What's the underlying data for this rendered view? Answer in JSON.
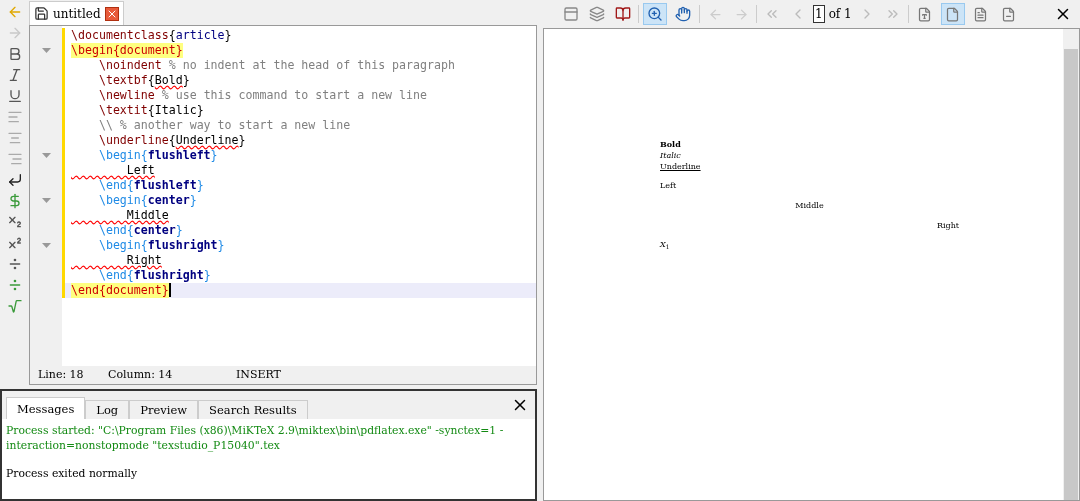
{
  "editor_tab": {
    "title": "untitled"
  },
  "code_lines": [
    {
      "foldable": false,
      "current": false,
      "tokens": [
        {
          "kind": "command",
          "text": "\\documentclass"
        },
        {
          "kind": "brace",
          "text": "{"
        },
        {
          "kind": "arg",
          "text": "article"
        },
        {
          "kind": "brace",
          "text": "}"
        }
      ]
    },
    {
      "foldable": true,
      "current": false,
      "tokens": [
        {
          "kind": "document",
          "text": "\\begin{document}"
        }
      ]
    },
    {
      "foldable": false,
      "current": false,
      "tokens": [
        {
          "kind": "command",
          "text": "    \\noindent"
        },
        {
          "kind": "comment",
          "text": " % no indent at the head of this paragraph"
        }
      ]
    },
    {
      "foldable": false,
      "current": false,
      "tokens": [
        {
          "kind": "command",
          "text": "    \\textbf"
        },
        {
          "kind": "brace",
          "text": "{"
        },
        {
          "kind": "misspelled",
          "text": "Bold"
        },
        {
          "kind": "brace",
          "text": "}"
        }
      ]
    },
    {
      "foldable": false,
      "current": false,
      "tokens": [
        {
          "kind": "command",
          "text": "    \\newline"
        },
        {
          "kind": "comment",
          "text": " % use this command to start a new line"
        }
      ]
    },
    {
      "foldable": false,
      "current": false,
      "tokens": [
        {
          "kind": "command",
          "text": "    \\textit"
        },
        {
          "kind": "brace",
          "text": "{"
        },
        {
          "kind": "text",
          "text": "Italic"
        },
        {
          "kind": "brace",
          "text": "}"
        }
      ]
    },
    {
      "foldable": false,
      "current": false,
      "tokens": [
        {
          "kind": "comment",
          "text": "    \\\\ % another way to start a new line"
        }
      ]
    },
    {
      "foldable": false,
      "current": false,
      "tokens": [
        {
          "kind": "command",
          "text": "    \\underline"
        },
        {
          "kind": "brace",
          "text": "{"
        },
        {
          "kind": "misspelled",
          "text": "Underline"
        },
        {
          "kind": "brace",
          "text": "}"
        }
      ]
    },
    {
      "foldable": true,
      "current": false,
      "tokens": [
        {
          "kind": "env",
          "text": "    \\begin{"
        },
        {
          "kind": "envname",
          "text": "flushleft"
        },
        {
          "kind": "env",
          "text": "}"
        }
      ]
    },
    {
      "foldable": false,
      "current": false,
      "tokens": [
        {
          "kind": "misspelled",
          "text": "        Left"
        }
      ]
    },
    {
      "foldable": false,
      "current": false,
      "tokens": [
        {
          "kind": "env",
          "text": "    \\end{"
        },
        {
          "kind": "envname",
          "text": "flushleft"
        },
        {
          "kind": "env",
          "text": "}"
        }
      ]
    },
    {
      "foldable": true,
      "current": false,
      "tokens": [
        {
          "kind": "env",
          "text": "    \\begin{"
        },
        {
          "kind": "envname",
          "text": "center"
        },
        {
          "kind": "env",
          "text": "}"
        }
      ]
    },
    {
      "foldable": false,
      "current": false,
      "tokens": [
        {
          "kind": "misspelled",
          "text": "        Middle"
        }
      ]
    },
    {
      "foldable": false,
      "current": false,
      "tokens": [
        {
          "kind": "env",
          "text": "    \\end{"
        },
        {
          "kind": "envname",
          "text": "center"
        },
        {
          "kind": "env",
          "text": "}"
        }
      ]
    },
    {
      "foldable": true,
      "current": false,
      "tokens": [
        {
          "kind": "env",
          "text": "    \\begin{"
        },
        {
          "kind": "envname",
          "text": "flushright"
        },
        {
          "kind": "env",
          "text": "}"
        }
      ]
    },
    {
      "foldable": false,
      "current": false,
      "tokens": [
        {
          "kind": "misspelled",
          "text": "        Right"
        }
      ]
    },
    {
      "foldable": false,
      "current": false,
      "tokens": [
        {
          "kind": "env",
          "text": "    \\end{"
        },
        {
          "kind": "envname",
          "text": "flushright"
        },
        {
          "kind": "env",
          "text": "}"
        }
      ]
    },
    {
      "foldable": false,
      "current": true,
      "tokens": [
        {
          "kind": "document",
          "text": "\\end{document}"
        }
      ]
    }
  ],
  "status_bar": {
    "line": "Line: 18",
    "column": "Column: 14",
    "mode": "INSERT"
  },
  "message_tabs": [
    {
      "label": "Messages",
      "selected": true
    },
    {
      "label": "Log",
      "selected": false
    },
    {
      "label": "Preview",
      "selected": false
    },
    {
      "label": "Search Results",
      "selected": false
    }
  ],
  "messages": [
    {
      "kind": "info",
      "text": "Process started: \"C:\\Program Files (x86)\\MiKTeX 2.9\\miktex\\bin\\pdflatex.exe\"  -synctex=1 -interaction=nonstopmode \"texstudio_P15040\".tex"
    },
    {
      "kind": "plain",
      "text": "Process exited normally"
    }
  ],
  "pdf_toolbar": {
    "page": "1",
    "of": "of 1",
    "tools": [
      {
        "kind": "zoom",
        "selected": true
      },
      {
        "kind": "hand",
        "selected": false
      }
    ],
    "views": [
      {
        "kind": "actual-size",
        "selected": false
      },
      {
        "kind": "fit-width",
        "selected": true
      },
      {
        "kind": "fit-text",
        "selected": false
      },
      {
        "kind": "fit-page",
        "selected": false
      }
    ]
  },
  "pdf_page": [
    {
      "kind": "bold",
      "text": "Bold"
    },
    {
      "kind": "italic",
      "text": "Italic"
    },
    {
      "kind": "underline",
      "text": "Underline"
    },
    {
      "kind": "left",
      "text": "Left"
    },
    {
      "kind": "center",
      "text": "Middle"
    },
    {
      "kind": "right",
      "text": "Right"
    },
    {
      "kind": "left",
      "text": "*X*$_{1}$"
    }
  ]
}
